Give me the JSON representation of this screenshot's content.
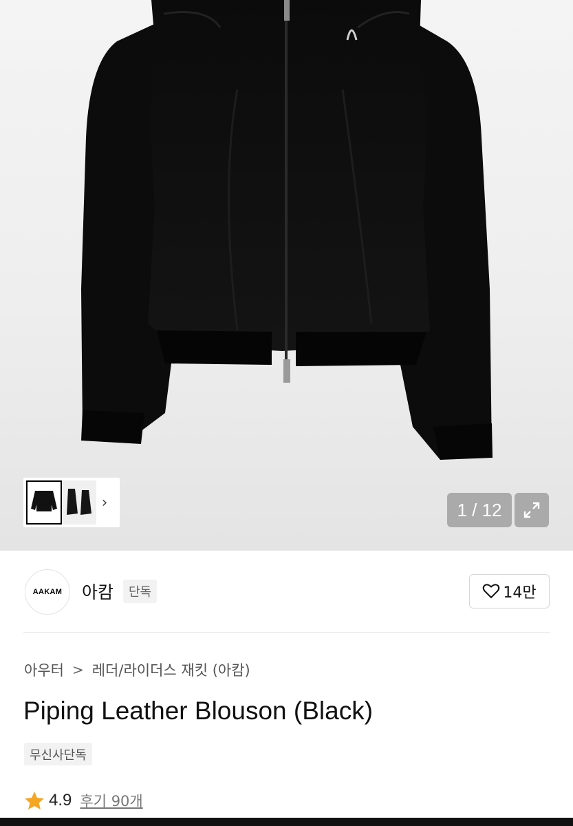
{
  "gallery": {
    "counter": "1 / 12",
    "thumbnails": [
      "jacket-front",
      "jacket-side"
    ],
    "more_icon": "chevron-right-icon",
    "expand_icon": "expand-icon"
  },
  "brand": {
    "logo_text": "AAKAM",
    "name": "아캄",
    "badge": "단독",
    "likes": "14만",
    "like_icon": "heart-icon"
  },
  "product": {
    "breadcrumb": [
      "아우터",
      "레더/라이더스 재킷 (아캄)"
    ],
    "breadcrumb_sep": ">",
    "title": "Piping Leather Blouson (Black)",
    "tag": "무신사단독",
    "rating": "4.9",
    "reviews": "후기 90개",
    "rating_icon": "star-icon",
    "rating_color": "#f5a623"
  }
}
